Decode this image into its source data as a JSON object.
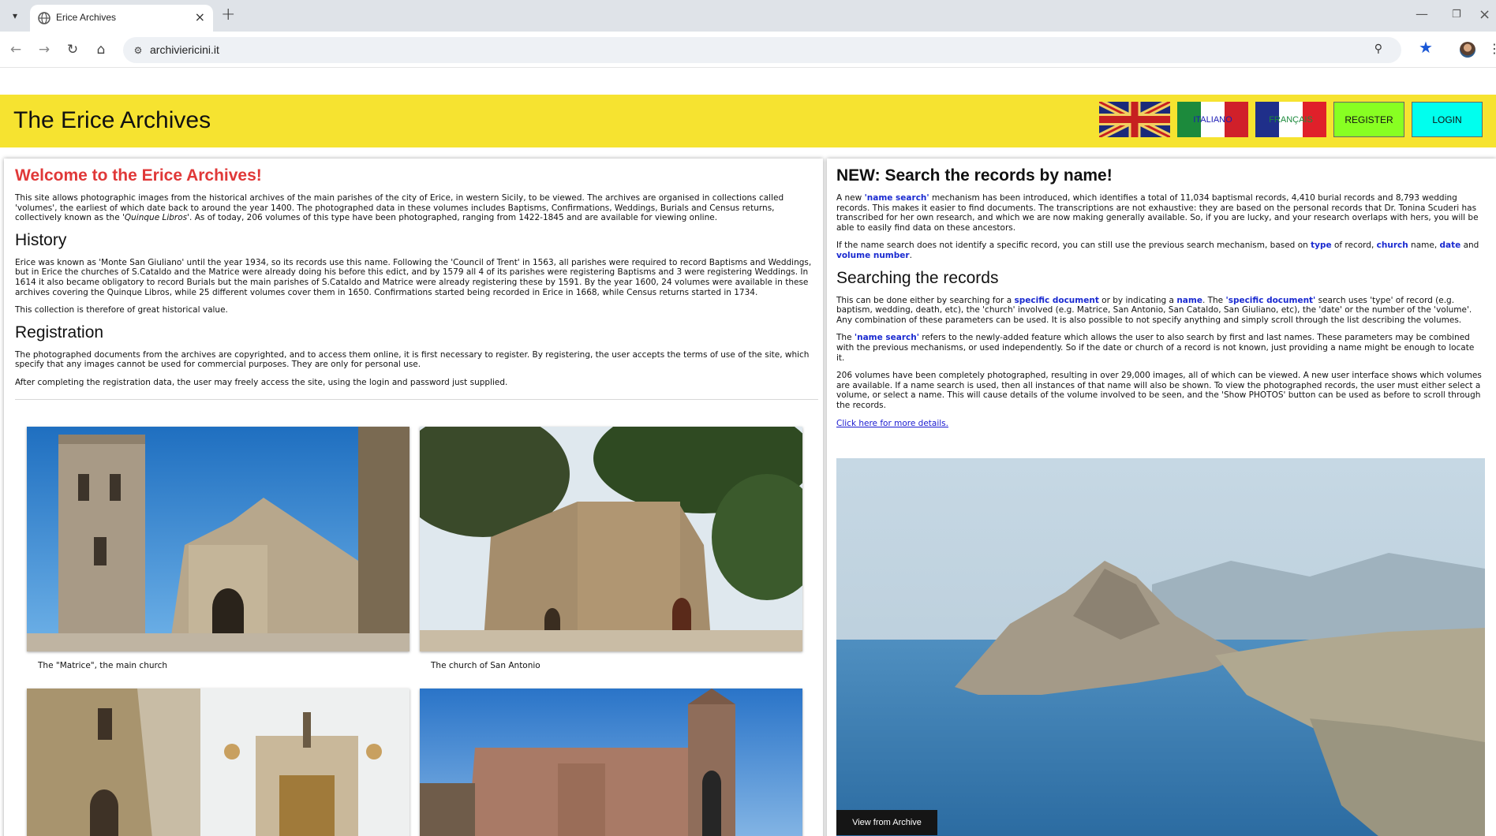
{
  "browser": {
    "tab_title": "Erice Archives",
    "url": "archiviericini.it",
    "new_tab_glyph": "+",
    "close_glyph": "×"
  },
  "header": {
    "site_title": "The Erice Archives",
    "languages": [
      {
        "label": "ENGLISH"
      },
      {
        "label": "ITALIANO"
      },
      {
        "label": "FRANÇAIS"
      }
    ],
    "register_label": "REGISTER",
    "login_label": "LOGIN"
  },
  "left": {
    "welcome_title": "Welcome to the Erice Archives!",
    "intro_1": "This site allows photographic images from the historical archives of the main parishes of the city of Erice, in western Sicily, to be viewed. The archives are organised in collections called 'volumes', the earliest of which date back to around the year 1400. The photographed data in these volumes includes Baptisms, Confirmations, Weddings, Burials and Census returns, collectively known as the ",
    "intro_italic": "'Quinque Libros'",
    "intro_2": ". As of today, 206 volumes of this type have been photographed, ranging from 1422-1845 and are available for viewing online.",
    "history_title": "History",
    "history_text": "Erice was known as 'Monte San Giuliano' until the year 1934, so its records use this name. Following the 'Council of Trent' in 1563, all parishes were required to record Baptisms and Weddings, but in Erice the churches of S.Cataldo and the Matrice were already doing his before this edict, and by 1579 all 4 of its parishes were registering Baptisms and 3 were registering Weddings. In 1614 it also became obligatory to record Burials but the main parishes of S.Cataldo and Matrice were already registering these by 1591. By the year 1600, 24 volumes were available in these archives covering the Quinque Libros, while 25 different volumes cover them in 1650. Confirmations started being recorded in Erice in 1668, while Census returns started in 1734.",
    "history_value": "This collection is therefore of great historical value.",
    "registration_title": "Registration",
    "registration_text_1": "The photographed documents from the archives are copyrighted, and to access them online, it is first necessary to register. By registering, the user accepts the terms of use of the site, which specify that any images cannot be used for commercial purposes. They are only for personal use.",
    "registration_text_2": "After completing the registration data, the user may freely access the site, using the login and password just supplied.",
    "captions": {
      "matrice": "The \"Matrice\", the main church",
      "san_antonio": "The church of San Antonio"
    }
  },
  "right": {
    "new_title": "NEW: Search the records by name!",
    "p1_a": "A new ",
    "p1_link": "'name search'",
    "p1_b": " mechanism has been introduced, which identifies a total of 11,034 baptismal records, 4,410 burial records and 8,793 wedding records. This makes it easier to find documents. The transcriptions are not exhaustive: they are based on the personal records that Dr. Tonina Scuderi has transcribed for her own research, and which we are now making generally available. So, if you are lucky, and your research overlaps with hers, you will be able to easily find data on these ancestors.",
    "p2_a": "If the name search does not identify a specific record, you can still use the previous search mechanism, based on ",
    "p2_type": "type",
    "p2_b": " of record, ",
    "p2_church": "church",
    "p2_c": " name, ",
    "p2_date": "date",
    "p2_d": " and ",
    "p2_volume": "volume number",
    "p2_e": ".",
    "searching_title": "Searching the records",
    "p3_a": "This can be done either by searching for a ",
    "p3_specific": "specific document",
    "p3_b": " or by indicating a ",
    "p3_name": "name",
    "p3_c": ". The ",
    "p3_specific2": "'specific document'",
    "p3_d": " search uses 'type' of record (e.g. baptism, wedding, death, etc), the 'church' involved (e.g. Matrice, San Antonio, San Cataldo, San Giuliano, etc), the 'date' or the number of the 'volume'. Any combination of these parameters can be used. It is also possible to not specify anything and simply scroll through the list describing the volumes.",
    "p4_a": "The ",
    "p4_name": "'name search'",
    "p4_b": " refers to the newly-added feature which allows the user to also search by first and last names. These parameters may be combined with the previous mechanisms, or used independently. So if the date or church of a record is not known, just providing a name might be enough to locate it.",
    "p5": "206 volumes have been completely photographed, resulting in over 29,000 images, all of which can be viewed. A new user interface shows which volumes are available. If a name search is used, then all instances of that name will also be shown. To view the photographed records, the user must either select a volume, or select a name. This will cause details of the volume involved to be seen, and the 'Show PHOTOS' button can be used as before to scroll through the records.",
    "more_link": "Click here for more details.",
    "view_badge": "View from Archive"
  }
}
